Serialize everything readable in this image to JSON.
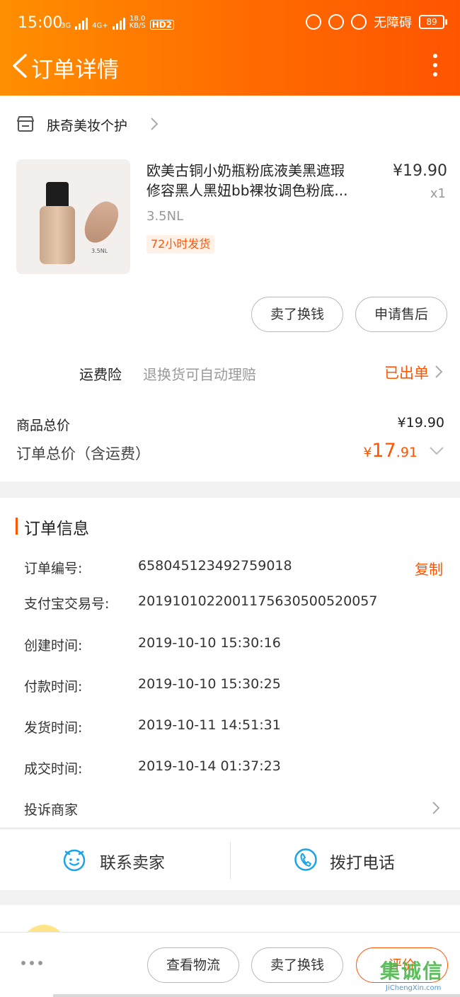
{
  "status_bar": {
    "time": "15:00",
    "network_1": "3G",
    "network_2": "4G+",
    "speed_value": "18.0",
    "speed_unit": "KB/S",
    "hd_badge": "HD2",
    "accessibility": "无障碍",
    "battery": "89"
  },
  "header": {
    "title": "订单详情"
  },
  "store": {
    "name": "肤奇美妆个护"
  },
  "product": {
    "title_line1": "欧美古铜小奶瓶粉底液美黑遮瑕",
    "title_line2": "修容黑人黑妞bb裸妆调色粉底...",
    "price": "¥19.90",
    "quantity": "x1",
    "sku": "3.5NL",
    "shipping_badge": "72小时发货",
    "image_label": "3.5NL"
  },
  "item_actions": {
    "sell_label": "卖了换钱",
    "aftersale_label": "申请售后"
  },
  "insurance": {
    "label": "运费险",
    "description": "退换货可自动理赔",
    "status": "已出单"
  },
  "totals": {
    "goods_total_label": "商品总价",
    "goods_total_value": "¥19.90",
    "order_total_label": "订单总价（含运费）",
    "order_total_currency": "¥",
    "order_total_integer": "17",
    "order_total_decimal": ".91"
  },
  "order_info": {
    "section_title": "订单信息",
    "copy_label": "复制",
    "rows": [
      {
        "label": "订单编号:",
        "value": "658045123492759018"
      },
      {
        "label": "支付宝交易号:",
        "value": "2019101022001175630500520057"
      },
      {
        "label": "创建时间:",
        "value": "2019-10-10 15:30:16"
      },
      {
        "label": "付款时间:",
        "value": "2019-10-10 15:30:25"
      },
      {
        "label": "发货时间:",
        "value": "2019-10-11 14:51:31"
      },
      {
        "label": "成交时间:",
        "value": "2019-10-14 01:37:23"
      }
    ],
    "complain_label": "投诉商家"
  },
  "contact": {
    "chat_label": "联系卖家",
    "call_label": "拨打电话"
  },
  "bottom_actions": {
    "logistics_label": "查看物流",
    "sell_label": "卖了换钱",
    "review_label": "评价"
  },
  "watermark": {
    "main": "集诚信",
    "sub": "JiChengXin.com"
  },
  "colors": {
    "accent": "#ff5500",
    "header_start": "#ff8f00",
    "header_end": "#ff5500",
    "icon_blue": "#1aa3e8"
  }
}
